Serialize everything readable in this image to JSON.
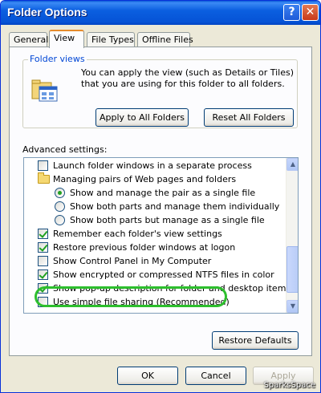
{
  "window": {
    "title": "Folder Options",
    "help_glyph": "?",
    "close_glyph": "✕"
  },
  "tabs": [
    {
      "label": "General"
    },
    {
      "label": "View"
    },
    {
      "label": "File Types"
    },
    {
      "label": "Offline Files"
    }
  ],
  "folder_views": {
    "legend": "Folder views",
    "description": "You can apply the view (such as Details or Tiles) that you are using for this folder to all folders.",
    "apply_button": "Apply to All Folders",
    "reset_button": "Reset All Folders"
  },
  "advanced": {
    "label": "Advanced settings:",
    "items": [
      {
        "text": "Launch folder windows in a separate process",
        "type": "checkbox",
        "checked": false
      },
      {
        "text": "Managing pairs of Web pages and folders",
        "type": "folder",
        "checked": false
      },
      {
        "text": "Show and manage the pair as a single file",
        "type": "radio",
        "checked": true
      },
      {
        "text": "Show both parts and manage them individually",
        "type": "radio",
        "checked": false
      },
      {
        "text": "Show both parts but manage as a single file",
        "type": "radio",
        "checked": false
      },
      {
        "text": "Remember each folder's view settings",
        "type": "checkbox",
        "checked": true
      },
      {
        "text": "Restore previous folder windows at logon",
        "type": "checkbox",
        "checked": true
      },
      {
        "text": "Show Control Panel in My Computer",
        "type": "checkbox",
        "checked": false
      },
      {
        "text": "Show encrypted or compressed NTFS files in color",
        "type": "checkbox",
        "checked": true
      },
      {
        "text": "Show pop-up description for folder and desktop items",
        "type": "checkbox",
        "checked": true
      },
      {
        "text": "Use simple file sharing (Recommended)",
        "type": "checkbox",
        "checked": false
      }
    ],
    "restore_button": "Restore Defaults"
  },
  "footer": {
    "ok": "OK",
    "cancel": "Cancel",
    "apply": "Apply"
  },
  "watermark": "SparksSpace",
  "colors": {
    "highlight": "#2dbf2d",
    "titlebar": "#0653d6",
    "legend": "#0046d5"
  }
}
